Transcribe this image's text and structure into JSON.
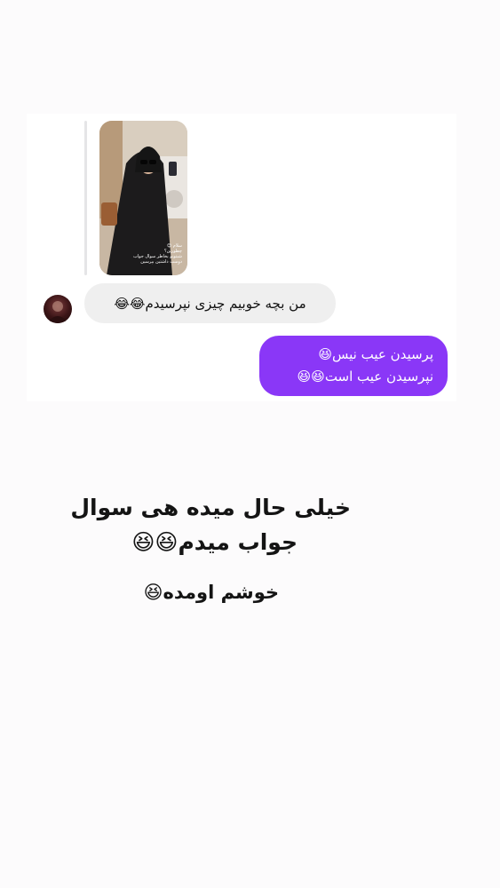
{
  "story_reply": {
    "thumbnail": "story-photo-woman-mirror-selfie",
    "caption_text": "سلام 😊\nچطورین؟\nشبتونو بخاطر سوال جواب\nدوست داشتین بپرسین"
  },
  "messages": {
    "incoming": {
      "text": "من بچه خوبیم چیزی نپرسیدم😂😂",
      "avatar": "sender-avatar"
    },
    "outgoing": {
      "line1": "پرسیدن عیب نیس😆",
      "line2": "نپرسیدن عیب است😆😆"
    }
  },
  "captions": {
    "line1": "خیلی حال میده هی سوال",
    "line2": "جواب میدم😆😆",
    "line3": "خوشم اومده😆"
  },
  "colors": {
    "outgoing_bubble": "#8a37f7",
    "incoming_bubble": "#efefef",
    "background": "#fcfbfc"
  }
}
